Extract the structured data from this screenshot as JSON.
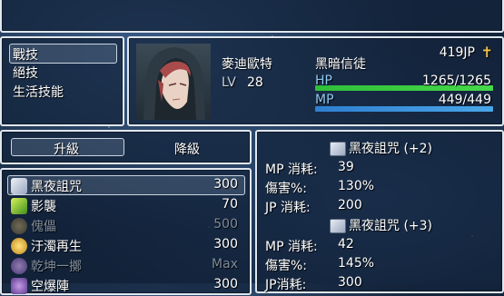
{
  "help": {
    "text": ""
  },
  "categories": {
    "items": [
      {
        "label": "戰技",
        "selected": true
      },
      {
        "label": "絕技",
        "selected": false
      },
      {
        "label": "生活技能",
        "selected": false
      }
    ]
  },
  "actor": {
    "name": "麥迪歐特",
    "level_label": "LV",
    "level": "28",
    "class": "黑暗信徒",
    "jp": "419JP",
    "jp_icon": "cross-icon",
    "hp_label": "HP",
    "hp": "1265/1265",
    "hp_ratio": 1.0,
    "mp_label": "MP",
    "mp": "449/449",
    "mp_ratio": 1.0,
    "colors": {
      "hp": "#2fbf3a",
      "mp": "#3a8fd8"
    }
  },
  "commands": {
    "upgrade": "升級",
    "downgrade": "降級"
  },
  "skills": [
    {
      "name": "黑夜詛咒",
      "cost": "300",
      "icon": "dark-book-icon",
      "enabled": true,
      "selected": true
    },
    {
      "name": "影襲",
      "cost": "70",
      "icon": "shadow-strike-icon",
      "enabled": true,
      "selected": false
    },
    {
      "name": "傀儡",
      "cost": "500",
      "icon": "puppet-icon",
      "enabled": false,
      "selected": false
    },
    {
      "name": "汙濁再生",
      "cost": "300",
      "icon": "regen-icon",
      "enabled": true,
      "selected": false
    },
    {
      "name": "乾坤一擲",
      "cost": "Max",
      "icon": "throw-icon",
      "enabled": false,
      "selected": false
    },
    {
      "name": "空爆陣",
      "cost": "300",
      "icon": "blast-icon",
      "enabled": true,
      "selected": false
    }
  ],
  "detail": {
    "current": {
      "title": "黑夜詛咒 (+2)",
      "rows": [
        {
          "label": "MP 消耗:",
          "value": "39"
        },
        {
          "label": "傷害%:",
          "value": "130%"
        },
        {
          "label": "JP 消耗:",
          "value": "200"
        }
      ]
    },
    "next": {
      "title": "黑夜詛咒 (+3)",
      "rows": [
        {
          "label": "MP 消耗:",
          "value": "42"
        },
        {
          "label": "傷害%:",
          "value": "145%"
        },
        {
          "label": "JP消耗:",
          "value": "300"
        }
      ]
    }
  }
}
